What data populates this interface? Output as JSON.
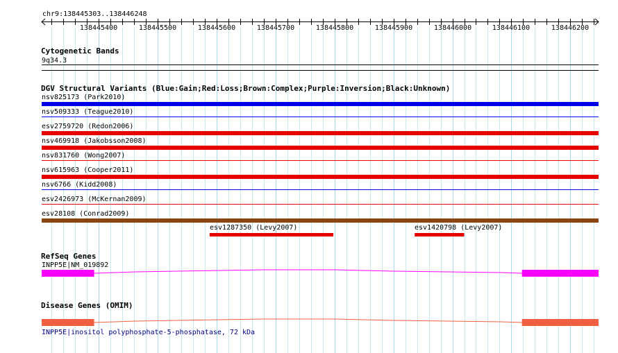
{
  "ruler": {
    "region_label": "chr9:138445303..138446248",
    "region_start": 138445303,
    "region_end": 138446248,
    "ticks": [
      138445400,
      138445500,
      138445600,
      138445700,
      138445800,
      138445900,
      138446000,
      138446100,
      138446200
    ]
  },
  "cytoband": {
    "title": "Cytogenetic Bands",
    "band": "9q34.3"
  },
  "dgv": {
    "title": "DGV Structural Variants (Blue:Gain;Red:Loss;Brown:Complex;Purple:Inversion;Black:Unknown)",
    "variants": [
      {
        "label": "nsv825173 (Park2010)",
        "color": "#0000e6",
        "start": 138445303,
        "end": 138446248,
        "thick": true
      },
      {
        "label": "nsv509333 (Teague2010)",
        "color": "#0000e6",
        "start": 138445303,
        "end": 138446248,
        "thick": false
      },
      {
        "label": "esv2759720 (Redon2006)",
        "color": "#e60000",
        "start": 138445303,
        "end": 138446248,
        "thick": true
      },
      {
        "label": "nsv469918 (Jakobsson2008)",
        "color": "#e60000",
        "start": 138445303,
        "end": 138446248,
        "thick": true
      },
      {
        "label": "nsv831760 (Wong2007)",
        "color": "#e60000",
        "start": 138445303,
        "end": 138446248,
        "thick": false
      },
      {
        "label": "nsv615963 (Cooper2011)",
        "color": "#e60000",
        "start": 138445303,
        "end": 138446248,
        "thick": true
      },
      {
        "label": "nsv6766 (Kidd2008)",
        "color": "#0000e6",
        "start": 138445303,
        "end": 138446248,
        "thick": false
      },
      {
        "label": "esv2426973 (McKernan2009)",
        "color": "#e60000",
        "start": 138445303,
        "end": 138446248,
        "thick": false
      },
      {
        "label": "esv28108 (Conrad2009)",
        "color": "#8b4513",
        "start": 138445303,
        "end": 138446248,
        "thick": true
      }
    ],
    "small_variants": [
      {
        "label": "esv1287350 (Levy2007)",
        "color": "#e60000",
        "start": 138445588,
        "end": 138445798
      },
      {
        "label": "esv1420798 (Levy2007)",
        "color": "#e60000",
        "start": 138445936,
        "end": 138446020
      }
    ]
  },
  "refseq": {
    "title": "RefSeq Genes",
    "gene_label": "INPP5E|NM_019892",
    "color": "#ff00ff",
    "exons": [
      {
        "start": 138445303,
        "end": 138445392
      },
      {
        "start": 138446118,
        "end": 138446248
      }
    ]
  },
  "omim": {
    "title": "Disease Genes (OMIM)",
    "gene_label": "INPP5E|inositol polyphosphate-5-phosphatase, 72 kDa",
    "color": "#f06040",
    "label_color": "#000080",
    "exons": [
      {
        "start": 138445303,
        "end": 138445392
      },
      {
        "start": 138446118,
        "end": 138446248
      }
    ]
  }
}
